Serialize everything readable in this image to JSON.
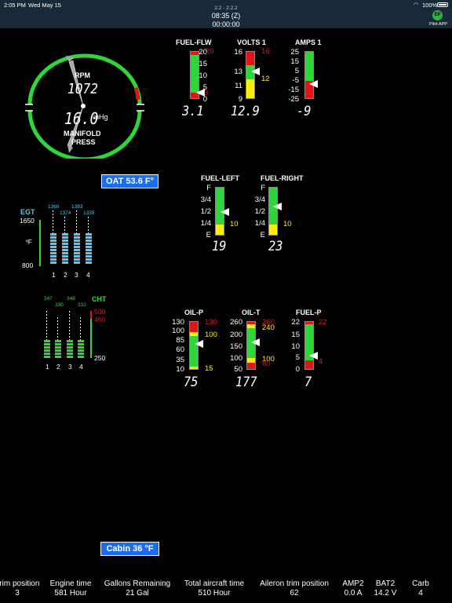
{
  "status_bar": {
    "time": "2:05 PM",
    "date": "Wed May 15",
    "version": "2.2 - 2.2.2",
    "clock_utc": "08:35 (Z)",
    "timer": "00:00:00",
    "battery": "100%",
    "app_label": "Pilot APP"
  },
  "rpm_gauge": {
    "rpm_label": "RPM",
    "rpm_value": "1072",
    "map_value": "16.0",
    "map_unit": "inHg",
    "map_label_1": "MANIFOLD",
    "map_label_2": "PRESS"
  },
  "oat": "OAT 53.6 F°",
  "cabin": "Cabin 36 °F",
  "gauges_top": {
    "fuel_flow": {
      "label": "FUEL-FLW",
      "ticks": [
        "20",
        "15",
        "10",
        "5",
        "0"
      ],
      "red_ticks": [
        "20",
        "3"
      ],
      "value": "3.1",
      "level": 3.1,
      "min": 0,
      "max": 20
    },
    "volts": {
      "label": "VOLTS 1",
      "ticks": [
        "16",
        "13",
        "11",
        "9"
      ],
      "red_tick": "16",
      "yellow_tick": "12",
      "value": "12.9",
      "level": 12.9,
      "min": 9,
      "max": 16
    },
    "amps": {
      "label": "AMPS 1",
      "ticks": [
        "25",
        "15",
        "5",
        "-5",
        "-15",
        "-25"
      ],
      "value": "-9",
      "level": -9,
      "min": -25,
      "max": 25
    }
  },
  "fuel_tanks": {
    "left": {
      "label": "FUEL-LEFT",
      "ticks": [
        "F",
        "3/4",
        "1/2",
        "1/4",
        "E"
      ],
      "yellow_tick": "10",
      "value": "19",
      "level_fraction": 0.5
    },
    "right": {
      "label": "FUEL-RIGHT",
      "ticks": [
        "F",
        "3/4",
        "1/2",
        "1/4",
        "E"
      ],
      "yellow_tick": "10",
      "value": "23",
      "level_fraction": 0.6
    }
  },
  "egt": {
    "label": "EGT",
    "max_tick": "1650",
    "min_tick": "800",
    "unit": "ºF",
    "cyl_values": [
      "1360",
      "1374",
      "1383",
      "1335"
    ],
    "cyl_labels": [
      "1",
      "2",
      "3",
      "4"
    ]
  },
  "cht": {
    "label": "CHT",
    "ticks": [
      "500",
      "460",
      "250"
    ],
    "cyl_values": [
      "347",
      "330",
      "348",
      "332"
    ],
    "cyl_labels": [
      "1",
      "2",
      "3",
      "4"
    ]
  },
  "gauges_bottom": {
    "oil_p": {
      "label": "OIL-P",
      "ticks": [
        "130",
        "100",
        "85",
        "60",
        "35",
        "10"
      ],
      "red_tick": "130",
      "yellow_ticks": [
        "100",
        "15"
      ],
      "value": "75",
      "level": 75,
      "min": 10,
      "max": 130
    },
    "oil_t": {
      "label": "OIL-T",
      "ticks": [
        "260",
        "200",
        "150",
        "100",
        "50"
      ],
      "red_ticks": [
        "260",
        "80"
      ],
      "yellow_ticks": [
        "240",
        "100"
      ],
      "value": "177",
      "level": 177,
      "min": 50,
      "max": 260
    },
    "fuel_p": {
      "label": "FUEL-P",
      "ticks": [
        "22",
        "15",
        "10",
        "5",
        "0"
      ],
      "red_ticks": [
        "22",
        "4"
      ],
      "value": "7",
      "level": 7,
      "min": 0,
      "max": 22
    }
  },
  "bottom_bar": [
    {
      "h": "Trim position",
      "v": "3"
    },
    {
      "h": "Engine time",
      "v": "581 Hour"
    },
    {
      "h": "Gallons Remaining",
      "v": "21 Gal"
    },
    {
      "h": "Total aircraft time",
      "v": "510 Hour"
    },
    {
      "h": "Aileron trim position",
      "v": "62"
    },
    {
      "h": "AMP2",
      "v": "0.0 A"
    },
    {
      "h": "BAT2",
      "v": "14.2 V"
    },
    {
      "h": "Carb",
      "v": "4"
    }
  ],
  "colors": {
    "green": "#2fd63a",
    "red": "#e01515",
    "yellow": "#ffee00",
    "cyan": "#5bc8f0",
    "button_blue": "#1a6cf0",
    "status_bg": "#182a3a"
  }
}
